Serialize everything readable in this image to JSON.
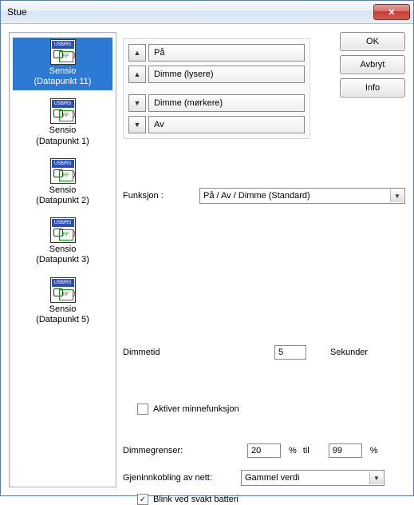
{
  "window": {
    "title": "Stue",
    "close_glyph": "✕"
  },
  "devices": [
    {
      "name": "Sensio",
      "sub": "(Datapunkt 11)",
      "selected": true
    },
    {
      "name": "Sensio",
      "sub": "(Datapunkt 1)",
      "selected": false
    },
    {
      "name": "Sensio",
      "sub": "(Datapunkt 2)",
      "selected": false
    },
    {
      "name": "Sensio",
      "sub": "(Datapunkt 3)",
      "selected": false
    },
    {
      "name": "Sensio",
      "sub": "(Datapunkt 5)",
      "selected": false
    }
  ],
  "icon": {
    "top_text": "USB/RS",
    "rf_text": "RF"
  },
  "action_rows": [
    {
      "glyph": "▲",
      "label": "På"
    },
    {
      "glyph": "▲",
      "label": "Dimme (lysere)"
    },
    {
      "glyph": "▼",
      "label": "Dimme (mørkere)"
    },
    {
      "glyph": "▼",
      "label": "Av"
    }
  ],
  "buttons": {
    "ok": "OK",
    "cancel": "Avbryt",
    "info": "Info"
  },
  "funksjon": {
    "label": "Funksjon :",
    "value": "På / Av / Dimme (Standard)"
  },
  "dimmetid": {
    "label": "Dimmetid",
    "value": "5",
    "unit": "Sekunder"
  },
  "memory": {
    "label": "Aktiver minnefunksjon",
    "checked": false
  },
  "limits": {
    "label": "Dimmegrenser:",
    "low": "20",
    "pct": "%",
    "til": "til",
    "high": "99"
  },
  "reconnect": {
    "label": "Gjeninnkobling av nett:",
    "value": "Gammel verdi"
  },
  "blink": {
    "label": "Blink ved svakt batteri",
    "checked": true
  }
}
